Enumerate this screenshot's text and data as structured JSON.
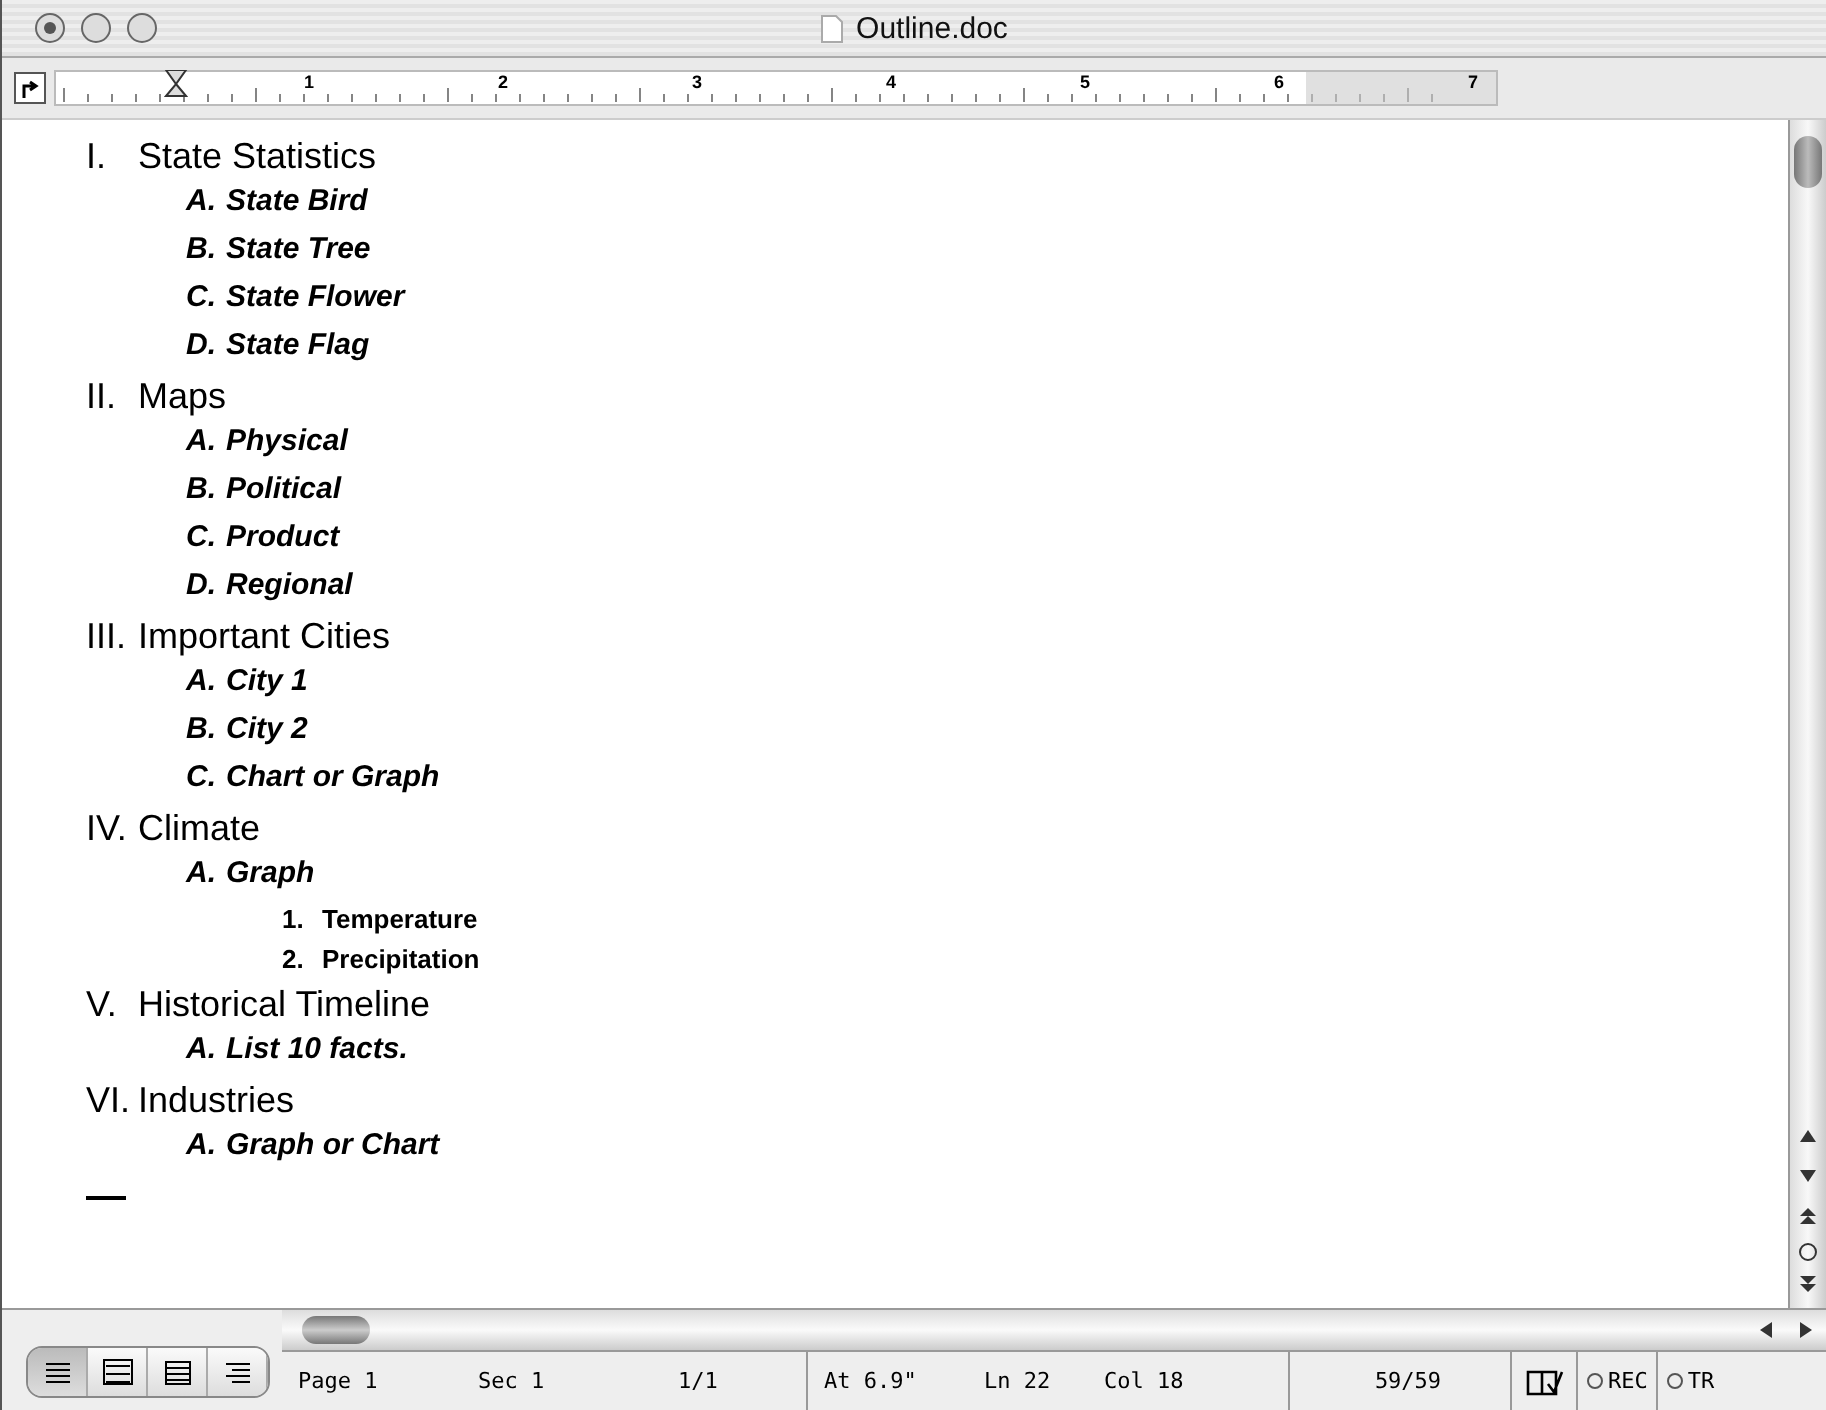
{
  "window": {
    "title": "Outline.doc"
  },
  "ruler": {
    "numbers": [
      "1",
      "2",
      "3",
      "4",
      "5",
      "6",
      "7"
    ]
  },
  "outline": [
    {
      "marker": "I.",
      "text": "State Statistics",
      "children": [
        {
          "marker": "A.",
          "text": "State Bird"
        },
        {
          "marker": "B.",
          "text": "State Tree"
        },
        {
          "marker": "C.",
          "text": "State Flower"
        },
        {
          "marker": "D.",
          "text": "State Flag"
        }
      ]
    },
    {
      "marker": "II.",
      "text": "Maps",
      "children": [
        {
          "marker": "A.",
          "text": "Physical"
        },
        {
          "marker": "B.",
          "text": "Political"
        },
        {
          "marker": "C.",
          "text": "Product"
        },
        {
          "marker": "D.",
          "text": "Regional"
        }
      ]
    },
    {
      "marker": "III.",
      "text": "Important Cities",
      "children": [
        {
          "marker": "A.",
          "text": "City 1"
        },
        {
          "marker": "B.",
          "text": "City 2"
        },
        {
          "marker": "C.",
          "text": "Chart or Graph"
        }
      ]
    },
    {
      "marker": "IV.",
      "text": "Climate",
      "children": [
        {
          "marker": "A.",
          "text": "Graph",
          "children": [
            {
              "marker": "1.",
              "text": "Temperature"
            },
            {
              "marker": "2.",
              "text": "Precipitation"
            }
          ]
        }
      ]
    },
    {
      "marker": "V.",
      "text": "Historical Timeline",
      "children": [
        {
          "marker": "A.",
          "text": "List 10 facts."
        }
      ]
    },
    {
      "marker": "VI.",
      "text": "Industries",
      "children": [
        {
          "marker": "A.",
          "text": "Graph or Chart"
        }
      ]
    }
  ],
  "view_buttons": [
    {
      "kind": "normal",
      "selected": true
    },
    {
      "kind": "online",
      "selected": false
    },
    {
      "kind": "page",
      "selected": false
    },
    {
      "kind": "outline",
      "selected": false
    }
  ],
  "status_bar": {
    "page": "Page 1",
    "section": "Sec 1",
    "pages": "1/1",
    "at": "At 6.9\"",
    "line": "Ln 22",
    "col": "Col 18",
    "words": "59/59",
    "rec": "REC",
    "trk": "TR"
  }
}
